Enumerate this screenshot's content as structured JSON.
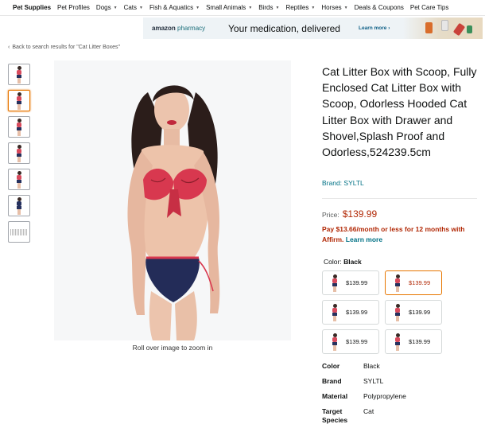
{
  "nav": {
    "items": [
      {
        "label": "Pet Supplies",
        "caret": false
      },
      {
        "label": "Pet Profiles",
        "caret": false
      },
      {
        "label": "Dogs",
        "caret": true
      },
      {
        "label": "Cats",
        "caret": true
      },
      {
        "label": "Fish & Aquatics",
        "caret": true
      },
      {
        "label": "Small Animals",
        "caret": true
      },
      {
        "label": "Birds",
        "caret": true
      },
      {
        "label": "Reptiles",
        "caret": true
      },
      {
        "label": "Horses",
        "caret": true
      },
      {
        "label": "Deals & Coupons",
        "caret": false
      },
      {
        "label": "Pet Care Tips",
        "caret": false
      }
    ]
  },
  "banner": {
    "logo_main": "amazon",
    "logo_sub": "pharmacy",
    "headline": "Your medication, delivered",
    "cta": "Learn more ›"
  },
  "breadcrumb": {
    "arrow": "‹",
    "text": "Back to search results for \"Cat Litter Boxes\""
  },
  "thumbnails": {
    "count": 7,
    "active_index": 1
  },
  "main_image": {
    "caption": "Roll over image to zoom in"
  },
  "product": {
    "title": "Cat Litter Box with Scoop, Fully Enclosed Cat Litter Box with Scoop, Odorless Hooded Cat Litter Box with Drawer and Shovel,Splash Proof and Odorless,524239.5cm",
    "brand_link": "Brand: SYLTL",
    "price_label": "Price:",
    "price": "$139.99",
    "affirm_text": "Pay $13.66/month or less for 12 months with Affirm.",
    "affirm_link": "Learn more",
    "color_label": "Color:",
    "color_value": "Black"
  },
  "swatches": [
    {
      "price": "$139.99",
      "selected": false
    },
    {
      "price": "$139.99",
      "selected": true
    },
    {
      "price": "$139.99",
      "selected": false
    },
    {
      "price": "$139.99",
      "selected": false
    },
    {
      "price": "$139.99",
      "selected": false
    },
    {
      "price": "$139.99",
      "selected": false
    }
  ],
  "specs": [
    {
      "key": "Color",
      "value": "Black"
    },
    {
      "key": "Brand",
      "value": "SYLTL"
    },
    {
      "key": "Material",
      "value": "Polypropylene"
    },
    {
      "key": "Target Species",
      "value": "Cat"
    }
  ],
  "colors": {
    "price_red": "#b12704",
    "link_teal": "#007185",
    "selected_orange": "#e77600"
  }
}
